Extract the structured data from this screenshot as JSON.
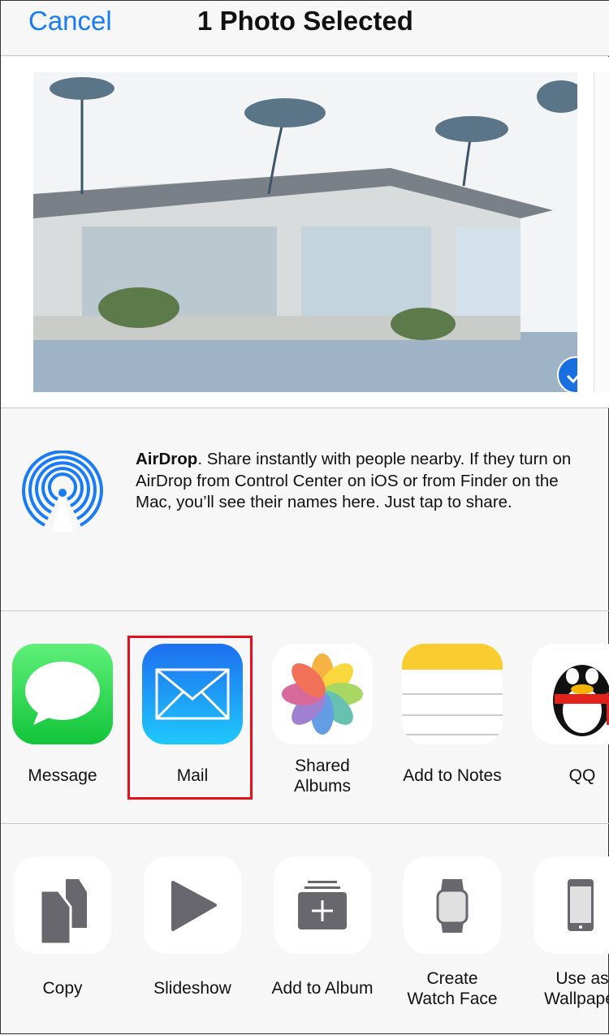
{
  "header": {
    "cancel_label": "Cancel",
    "title": "1 Photo Selected"
  },
  "airdrop": {
    "bold": "AirDrop",
    "text": ". Share instantly with people nearby. If they turn on AirDrop from Control Center on iOS or from Finder on the Mac, you’ll see their names here. Just tap to share."
  },
  "apps": [
    {
      "label": "Message",
      "icon": "message-icon"
    },
    {
      "label": "Mail",
      "icon": "mail-icon"
    },
    {
      "label": "Shared\nAlbums",
      "icon": "photos-icon"
    },
    {
      "label": "Add to Notes",
      "icon": "notes-icon"
    },
    {
      "label": "QQ",
      "icon": "qq-icon"
    }
  ],
  "actions": [
    {
      "label": "Copy",
      "icon": "copy-icon"
    },
    {
      "label": "Slideshow",
      "icon": "play-icon"
    },
    {
      "label": "Add to Album",
      "icon": "add-album-icon"
    },
    {
      "label": "Create\nWatch Face",
      "icon": "watch-icon"
    },
    {
      "label": "Use as\nWallpaper",
      "icon": "phone-icon"
    }
  ],
  "colors": {
    "accent": "#1a7cf5",
    "highlight": "#e8101a"
  }
}
